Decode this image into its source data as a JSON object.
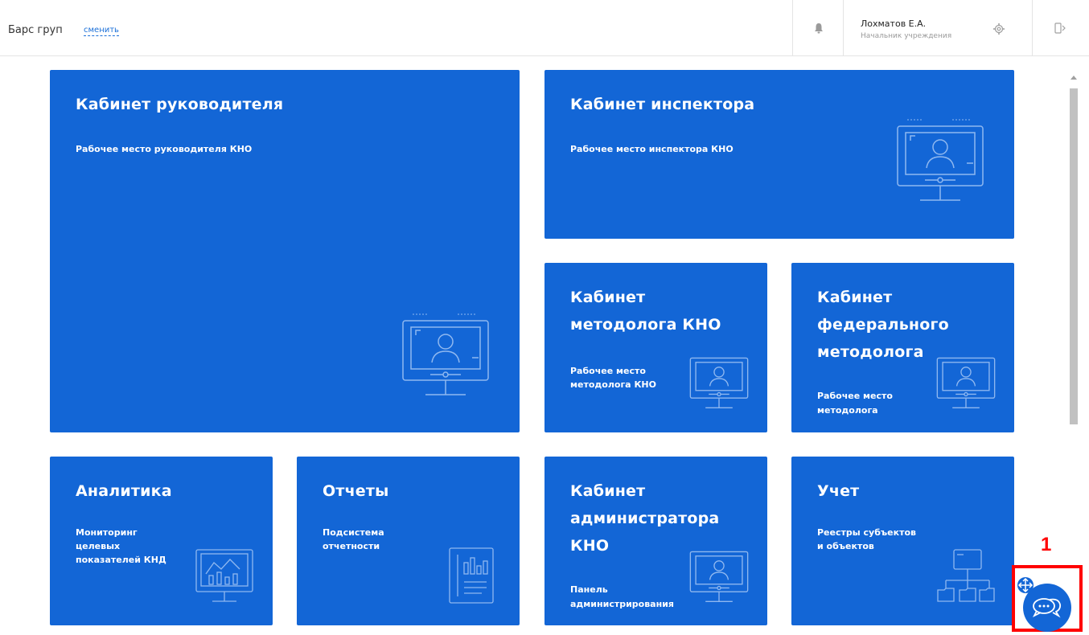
{
  "header": {
    "org_name": "Барс груп",
    "change_link": "сменить",
    "user_name": "Лохматов Е.А.",
    "user_role": "Начальник учреждения",
    "icons": [
      "bell-icon",
      "gear-icon",
      "logout-icon"
    ]
  },
  "tiles": {
    "manager": {
      "title": "Кабинет руководителя",
      "subtitle": "Рабочее место руководителя КНО",
      "icon": "monitor-user-icon"
    },
    "inspector": {
      "title": "Кабинет инспектора",
      "subtitle": "Рабочее место инспектора КНО",
      "icon": "monitor-user-icon"
    },
    "methodologist": {
      "title_line1": "Кабинет",
      "title_line2": "методолога КНО",
      "sub_line1": "Рабочее место",
      "sub_line2": "методолога КНО",
      "icon": "monitor-user-icon"
    },
    "federal": {
      "title_line1": "Кабинет",
      "title_line2": "федерального",
      "title_line3": "методолога",
      "sub_line1": "Рабочее место",
      "sub_line2": "методолога",
      "icon": "monitor-user-icon"
    },
    "analytics": {
      "title": "Аналитика",
      "sub_line1": "Мониторинг",
      "sub_line2": "целевых",
      "sub_line3": "показателей КНД",
      "icon": "monitor-chart-icon"
    },
    "reports": {
      "title": "Отчеты",
      "sub_line1": "Подсистема",
      "sub_line2": "отчетности",
      "icon": "report-document-icon"
    },
    "admin": {
      "title_line1": "Кабинет",
      "title_line2": "администратора",
      "title_line3": "КНО",
      "sub_line1": "Панель",
      "sub_line2": "администрирования",
      "icon": "monitor-user-icon"
    },
    "registry": {
      "title": "Учет",
      "sub_line1": "Реестры субъектов",
      "sub_line2": "и объектов",
      "icon": "hierarchy-icon"
    }
  },
  "annotation": {
    "marker": "1"
  },
  "colors": {
    "tile": "#1366d6",
    "accent": "#ff0000"
  }
}
